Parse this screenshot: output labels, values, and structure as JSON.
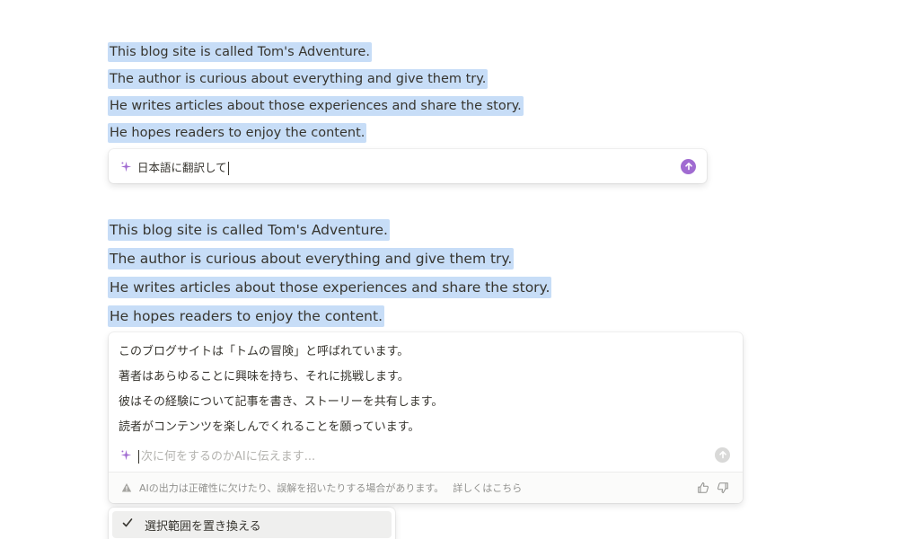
{
  "selection_1": {
    "lines": [
      "This blog site is called Tom's Adventure.",
      "The author is curious about everything and give them try.",
      "He writes articles about those experiences and share the story.",
      "He hopes readers to enjoy the content."
    ]
  },
  "prompt_1": {
    "value": "日本語に翻訳して",
    "sparkle_icon": "sparkle-icon",
    "send_icon": "arrow-up-icon",
    "accent": "#a06bd1"
  },
  "selection_2": {
    "lines": [
      "This blog site is called Tom's Adventure.",
      "The author is curious about everything and give them try.",
      "He writes articles about those experiences and share the story.",
      "He hopes readers to enjoy the content."
    ]
  },
  "result": {
    "lines": [
      "このブログサイトは「トムの冒険」と呼ばれています。",
      "著者はあらゆることに興味を持ち、それに挑戦します。",
      "彼はその経験について記事を書き、ストーリーを共有します。",
      "読者がコンテンツを楽しんでくれることを願っています。"
    ],
    "followup_placeholder": "次に何をするのかAIに伝えます...",
    "disclaimer": "AIの出力は正確性に欠けたり、誤解を招いたりする場合があります。",
    "learn_more": "詳しくはこちら"
  },
  "menu": {
    "items": [
      {
        "label": "選択範囲を置き換える",
        "icon": "check-icon"
      }
    ]
  },
  "colors": {
    "selection": "#c7ddf7",
    "text": "#37352f",
    "muted": "#91918e"
  }
}
